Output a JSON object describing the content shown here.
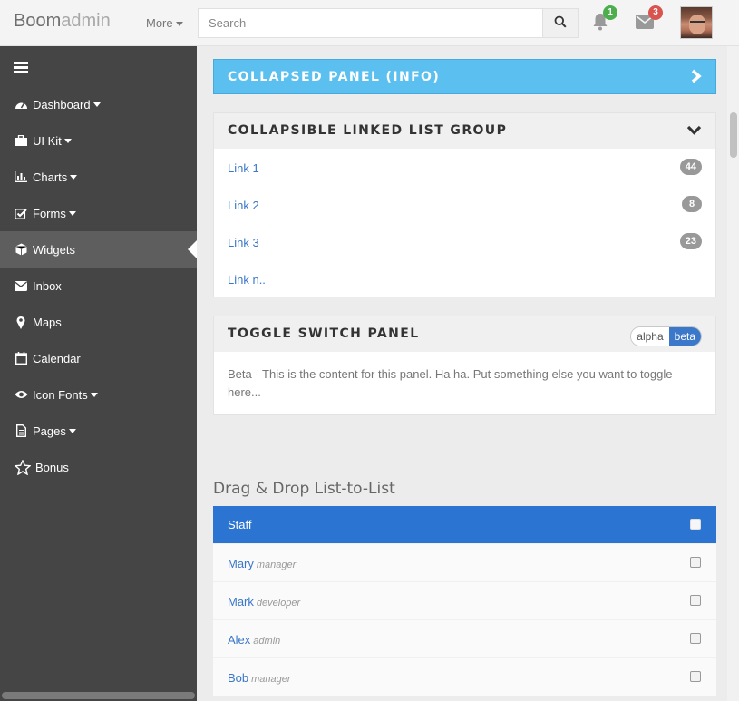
{
  "brand": {
    "part1": "Boom",
    "part2": "admin"
  },
  "topbar": {
    "more_label": "More",
    "search_placeholder": "Search",
    "notifications_count": "1",
    "messages_count": "3",
    "colors": {
      "notifications_badge": "#4cae4c",
      "messages_badge": "#d9534f"
    }
  },
  "sidebar": {
    "items": [
      {
        "label": "Dashboard",
        "icon": "dashboard-icon",
        "has_caret": true
      },
      {
        "label": "UI Kit",
        "icon": "briefcase-icon",
        "has_caret": true
      },
      {
        "label": "Charts",
        "icon": "bar-chart-icon",
        "has_caret": true
      },
      {
        "label": "Forms",
        "icon": "check-square-icon",
        "has_caret": true
      },
      {
        "label": "Widgets",
        "icon": "cube-icon",
        "has_caret": false,
        "active": true
      },
      {
        "label": "Inbox",
        "icon": "envelope-icon",
        "has_caret": false
      },
      {
        "label": "Maps",
        "icon": "map-marker-icon",
        "has_caret": false
      },
      {
        "label": "Calendar",
        "icon": "calendar-icon",
        "has_caret": false
      },
      {
        "label": "Icon Fonts",
        "icon": "eye-icon",
        "has_caret": true
      },
      {
        "label": "Pages",
        "icon": "file-icon",
        "has_caret": true
      },
      {
        "label": "Bonus",
        "icon": "star-icon",
        "has_caret": false
      }
    ]
  },
  "panels": {
    "collapsed_info": {
      "title": "COLLAPSED PANEL (INFO)"
    },
    "linked_list": {
      "title": "COLLAPSIBLE LINKED LIST GROUP",
      "links": [
        {
          "label": "Link 1",
          "badge": "44"
        },
        {
          "label": "Link 2",
          "badge": "8"
        },
        {
          "label": "Link 3",
          "badge": "23"
        },
        {
          "label": "Link n..",
          "badge": ""
        }
      ]
    },
    "toggle_switch": {
      "title": "TOGGLE SWITCH PANEL",
      "option_a": "alpha",
      "option_b": "beta",
      "selected": "beta",
      "content": "Beta - This is the content for this panel. Ha ha. Put something else you want to toggle here..."
    }
  },
  "drag_drop": {
    "title": "Drag & Drop List-to-List",
    "header": "Staff",
    "items": [
      {
        "name": "Mary",
        "role": "manager"
      },
      {
        "name": "Mark",
        "role": "developer"
      },
      {
        "name": "Alex",
        "role": "admin"
      },
      {
        "name": "Bob",
        "role": "manager"
      }
    ]
  },
  "colors": {
    "sidebar_bg": "#454545",
    "info_panel": "#5bc0f0",
    "list_header": "#2b74d2",
    "link": "#3a77c8"
  }
}
